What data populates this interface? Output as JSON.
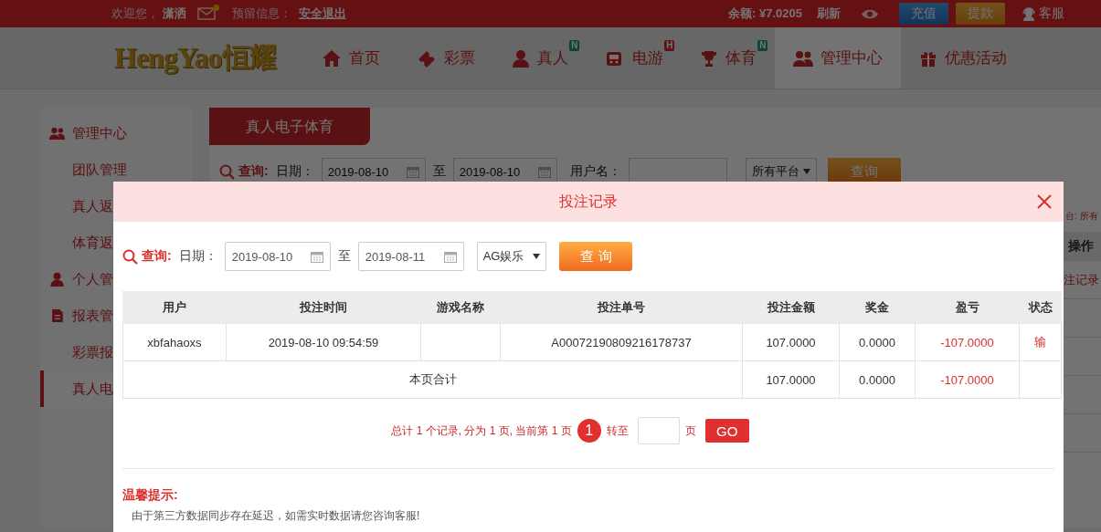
{
  "top_bar": {
    "welcome": "欢迎您，",
    "username": "潇洒",
    "unread_mail": true,
    "reserved_label": "预留信息：",
    "logout": "安全退出",
    "balance": "余额: ¥7.0205",
    "refresh": "刷新",
    "deposit": "充值",
    "withdraw": "提款",
    "service": "客服"
  },
  "navbar": {
    "logo_latin": "HengYao",
    "logo_cjk": "恒耀",
    "items": [
      {
        "label": "首页",
        "selected": false
      },
      {
        "label": "彩票",
        "selected": false
      },
      {
        "label": "真人",
        "selected": false,
        "badge": {
          "text": "N",
          "kind": "new"
        }
      },
      {
        "label": "电游",
        "selected": false,
        "badge": {
          "text": "H",
          "kind": "hot"
        }
      },
      {
        "label": "体育",
        "selected": false,
        "badge": {
          "text": "N",
          "kind": "new"
        }
      },
      {
        "label": "管理中心",
        "selected": true
      },
      {
        "label": "优惠活动",
        "selected": false
      }
    ]
  },
  "sidebar": {
    "groups": [
      {
        "label": "管理中心",
        "children": [
          {
            "label": "团队管理",
            "selected": false
          },
          {
            "label": "真人返",
            "selected": false
          },
          {
            "label": "体育返",
            "selected": false
          }
        ]
      },
      {
        "label": "个人管"
      },
      {
        "label": "报表管",
        "children": [
          {
            "label": "彩票报",
            "selected": false
          },
          {
            "label": "真人电",
            "selected": true
          }
        ]
      }
    ]
  },
  "content": {
    "tab": "真人电子体育",
    "query": {
      "label": "查询:",
      "date_label": "日期：",
      "date_from": "2019-08-10",
      "to": "至",
      "date_to": "2019-08-10",
      "user_label": "用户名：",
      "platform": "所有平台",
      "button": "查询"
    },
    "platform_note": "台: 所有",
    "column_last": "操作",
    "row_link": "注记录"
  },
  "modal": {
    "title": "投注记录",
    "query": {
      "label": "查询:",
      "date_label": "日期：",
      "date_from": "2019-08-10",
      "to": "至",
      "date_to": "2019-08-11",
      "platform": "AG娱乐",
      "button": "查 询"
    },
    "table": {
      "columns": [
        "用户",
        "投注时间",
        "游戏名称",
        "投注单号",
        "投注金额",
        "奖金",
        "盈亏",
        "状态"
      ],
      "rows": [
        [
          "xbfahaoxs",
          "2019-08-10 09:54:59",
          "",
          "A00072190809216178737",
          "107.0000",
          "0.0000",
          "-107.0000",
          "输"
        ]
      ],
      "total": {
        "label": "本页合计",
        "amount": "107.0000",
        "bonus": "0.0000",
        "profit": "-107.0000"
      }
    },
    "pager": {
      "summary": "总计 1 个记录, 分为 1 页, 当前第 1 页",
      "current": "1",
      "goto": "转至",
      "page": "页",
      "go": "GO"
    },
    "tips_title": "温馨提示:",
    "tips_text": "由于第三方数据同步存在延迟，如需实时数据请您咨询客服!"
  }
}
